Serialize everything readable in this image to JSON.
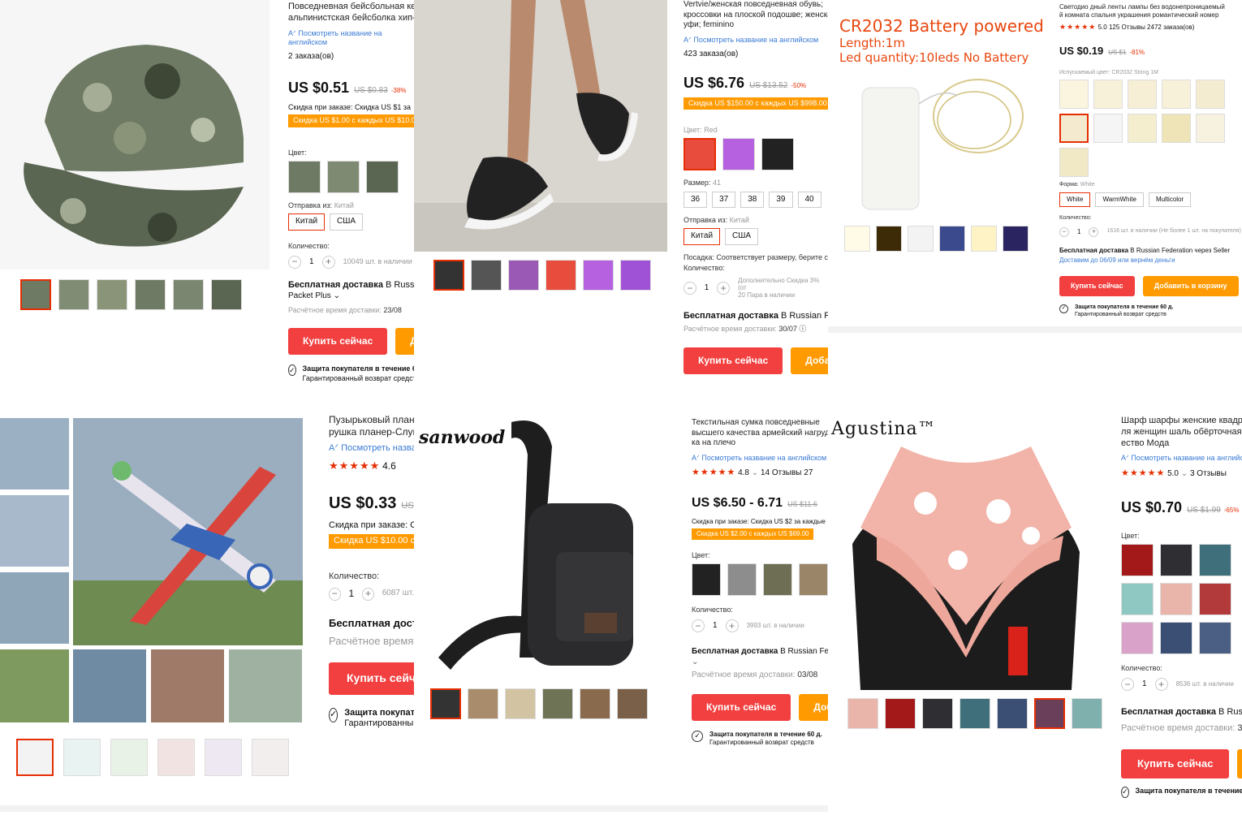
{
  "colors": {
    "accent": "#e62e04",
    "buy": "#f23f3f",
    "add": "#ff9a00",
    "link": "#3a7bd5"
  },
  "common": {
    "translate": "Посмотреть название на английском",
    "qty_label": "Количество:",
    "buy": "Купить сейчас",
    "add": "Добавить в корзину",
    "protect": "Защита покупателя в течение 60 д.",
    "refund": "Гарантированный возврат средств",
    "ship_from": "Отправка из:",
    "ship_free": "Бесплатная доставка",
    "delivery": "Расчётное время доставки:",
    "color": "Цвет:"
  },
  "p0": {
    "title1": "Повседневная бейсбольная кепка",
    "title2": "альпинистская бейсболка хип-хоп",
    "orders": "2 заказа(ов)",
    "price": "US $0.51",
    "old": "US $0.83",
    "pct": "-38%",
    "disc": "Скидка при заказе: Скидка US $1 за",
    "promo": "Скидка US $1.00 с каждых US $10.00",
    "from_val": "Китай",
    "opts": [
      "Китай",
      "США"
    ],
    "qty": "1",
    "stock": "10049 шт. в наличии",
    "ship_to": "В Russian Federation",
    "method": "Packet Plus",
    "delivery": "23/08"
  },
  "p1": {
    "title1": "Vertvie/женская повседневная обувь;",
    "title2": "кроссовки на плоской подошве; женская",
    "title3": "уфи; feminino",
    "orders": "423 заказа(ов)",
    "price": "US $6.76",
    "old": "US $13.52",
    "pct": "-50%",
    "promo": "Скидка US $150.00 с каждых US $998.00",
    "color_val": "Red",
    "size_label": "Размер:",
    "size_val": "41",
    "sizes": [
      "36",
      "37",
      "38",
      "39",
      "40"
    ],
    "from_val": "Китай",
    "opts": [
      "Китай",
      "США"
    ],
    "fit": "Посадка: Соответствует размеру, берите свой",
    "qty": "1",
    "extra1": "Дополнительно Скидка 3% (от",
    "extra2": "20 Пара в наличии",
    "ship_to": "В Russian Federation",
    "delivery": "30/07"
  },
  "p2": {
    "overlay1": "CR2032 Battery powered",
    "overlay2": "Length:1m",
    "overlay3": "Led quantity:10leds No Battery",
    "title1": "Светодио дный ленты лампы без водонепроницаемый",
    "title2": "й комната спальня украшения романтический номер",
    "rating": "5.0",
    "reviews": "125 Отзывы",
    "orders": "2472 заказа(ов)",
    "price": "US $0.19",
    "old": "US $1",
    "pct": "-81%",
    "color_label": "Испускаемый цвет:",
    "color_val": "CR2032 String 1M",
    "shape_label": "Форма:",
    "shape_val": "White",
    "shapes": [
      "White",
      "WarmWhite",
      "Multicolor"
    ],
    "qty": "1",
    "stock": "1616 шт. в наличии (Не более 1 шт. на покупателя)",
    "ship_to": "В Russian Federation через Seller",
    "guar": "Доставим до 06/09 или вернём деньги"
  },
  "p3": {
    "title1": "Пузырьковый планер",
    "title2": "рушка планер-Слугер",
    "rating": "4.6",
    "price": "US $0.33",
    "old": "US",
    "disc": "Скидка при заказе: С",
    "promo": "Скидка US $10.00 с",
    "qty": "1",
    "stock": "6087 шт.",
    "ship": "Бесплатная доставка",
    "delivery": "Расчётное время доставки",
    "buy": "Купить сейчас",
    "protect": "Защита покупателя",
    "refund": "Гарантированный возврат"
  },
  "p4": {
    "brand": "sanwood",
    "title1": "Текстильная сумка повседневные",
    "title2": "высшего качества армейский нагрудный",
    "title3": "ка на плечо",
    "rating": "4.8",
    "reviews": "14 Отзывы",
    "orders": "27",
    "price": "US $6.50 - 6.71",
    "old": "US $11.6",
    "disc": "Скидка при заказе: Скидка US $2 за каждые",
    "promo": "Скидка US $2.00 с каждых US $69.00",
    "qty": "1",
    "stock": "3993 шт. в наличии",
    "ship_to": "В Russian Federation",
    "delivery": "03/08"
  },
  "p5": {
    "brand": "Agustina™",
    "title1": "Шарф шарфы женские квадрат",
    "title2": "ля женщин шаль обёрточная",
    "title3": "ество Мода",
    "rating": "5.0",
    "reviews": "3 Отзывы",
    "price": "US $0.70",
    "old": "US $1.99",
    "pct": "-65%",
    "qty": "1",
    "stock": "8536 шт. в наличии",
    "ship_to": "В Russian Federation",
    "delivery": "3"
  }
}
